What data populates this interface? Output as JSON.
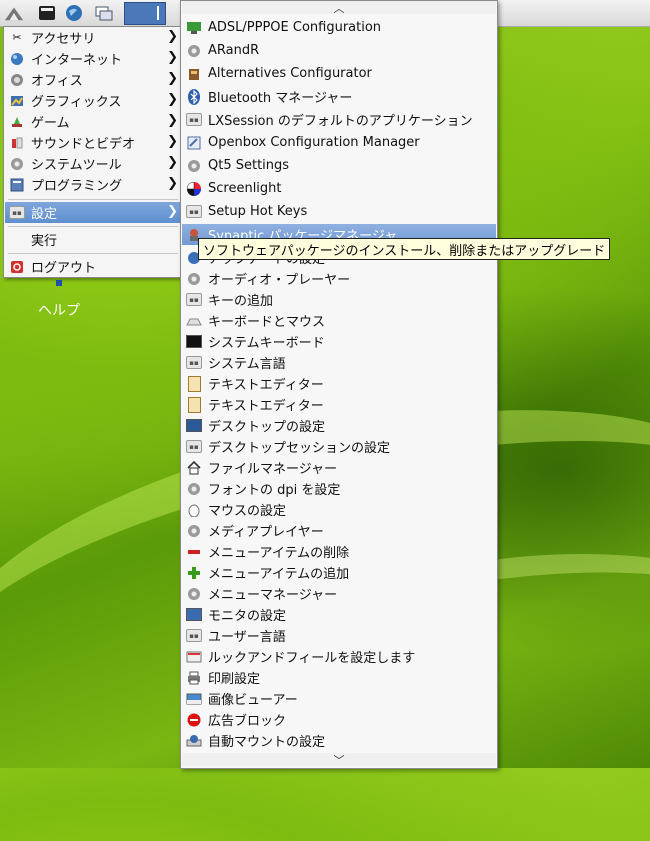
{
  "panel": {
    "icons": [
      "menu-launcher-icon",
      "terminal-icon",
      "web-browser-icon",
      "desktop-switch-icon"
    ]
  },
  "main_menu": {
    "items": [
      {
        "label": "アクセサリ",
        "icon": "accessories-icon",
        "submenu": true
      },
      {
        "label": "インターネット",
        "icon": "internet-icon",
        "submenu": true
      },
      {
        "label": "オフィス",
        "icon": "office-icon",
        "submenu": true
      },
      {
        "label": "グラフィックス",
        "icon": "graphics-icon",
        "submenu": true
      },
      {
        "label": "ゲーム",
        "icon": "games-icon",
        "submenu": true
      },
      {
        "label": "サウンドとビデオ",
        "icon": "sound-video-icon",
        "submenu": true
      },
      {
        "label": "システムツール",
        "icon": "system-tools-icon",
        "submenu": true
      },
      {
        "label": "プログラミング",
        "icon": "programming-icon",
        "submenu": true
      },
      {
        "label": "設定",
        "icon": "settings-icon",
        "submenu": true,
        "selected": true
      },
      {
        "label": "実行",
        "icon": "",
        "submenu": false
      },
      {
        "label": "ログアウト",
        "icon": "logout-icon",
        "submenu": false
      }
    ],
    "arrow": "❯"
  },
  "desktop": {
    "help_label": "ヘルプ"
  },
  "settings_menu": {
    "scroll_up": "︿",
    "scroll_down": "﹀",
    "items": [
      {
        "label": "ADSL/PPPOE Configuration",
        "icon": "network-config-icon"
      },
      {
        "label": "ARandR",
        "icon": "gear-icon"
      },
      {
        "label": "Alternatives Configurator",
        "icon": "alternatives-icon"
      },
      {
        "label": "Bluetooth マネージャー",
        "icon": "bluetooth-icon"
      },
      {
        "label": "LXSession のデフォルトのアプリケーション",
        "icon": "keyboard-icon"
      },
      {
        "label": "Openbox Configuration Manager",
        "icon": "openbox-icon"
      },
      {
        "label": "Qt5 Settings",
        "icon": "gear-icon"
      },
      {
        "label": "Screenlight",
        "icon": "screenlight-icon"
      },
      {
        "label": "Setup Hot Keys",
        "icon": "keyboard-icon"
      },
      {
        "label": "Synaptic パッケージマネージャ",
        "icon": "synaptic-icon",
        "highlighted": true
      },
      {
        "label": "アップデートの設定",
        "icon": "update-settings-icon"
      },
      {
        "label": "オーディオ・プレーヤー",
        "icon": "gear-icon"
      },
      {
        "label": "キーの追加",
        "icon": "keyboard-icon"
      },
      {
        "label": "キーボードとマウス",
        "icon": "keyboard-mouse-icon"
      },
      {
        "label": "システムキーボード",
        "icon": "monitor-icon"
      },
      {
        "label": "システム言語",
        "icon": "keyboard-icon"
      },
      {
        "label": "テキストエディター",
        "icon": "text-editor-icon"
      },
      {
        "label": "テキストエディター",
        "icon": "text-editor-icon"
      },
      {
        "label": "デスクトップの設定",
        "icon": "desktop-settings-icon"
      },
      {
        "label": "デスクトップセッションの設定",
        "icon": "keyboard-icon"
      },
      {
        "label": "ファイルマネージャー",
        "icon": "home-icon"
      },
      {
        "label": "フォントの dpi を設定",
        "icon": "gear-icon"
      },
      {
        "label": "マウスの設定",
        "icon": "mouse-icon"
      },
      {
        "label": "メディアプレイヤー",
        "icon": "gear-icon"
      },
      {
        "label": "メニューアイテムの削除",
        "icon": "minus-icon"
      },
      {
        "label": "メニューアイテムの追加",
        "icon": "plus-icon"
      },
      {
        "label": "メニューマネージャー",
        "icon": "gear-icon"
      },
      {
        "label": "モニタの設定",
        "icon": "monitor-icon"
      },
      {
        "label": "ユーザー言語",
        "icon": "keyboard-icon"
      },
      {
        "label": "ルックアンドフィールを設定します",
        "icon": "appearance-icon"
      },
      {
        "label": "印刷設定",
        "icon": "printer-icon"
      },
      {
        "label": "画像ビューアー",
        "icon": "image-viewer-icon"
      },
      {
        "label": "広告ブロック",
        "icon": "block-icon"
      },
      {
        "label": "自動マウントの設定",
        "icon": "automount-icon"
      }
    ]
  },
  "tooltip": {
    "text": "ソフトウェアパッケージのインストール、削除またはアップグレード"
  },
  "colors": {
    "selection": "#6b97d6",
    "menu_bg": "#f5f5f5",
    "tooltip_bg": "#ffffdd"
  }
}
